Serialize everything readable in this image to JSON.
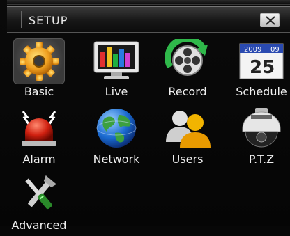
{
  "window": {
    "title": "SETUP",
    "close_label": "close"
  },
  "menu": {
    "items": [
      {
        "id": "basic",
        "label": "Basic",
        "icon": "gear-icon",
        "selected": true
      },
      {
        "id": "live",
        "label": "Live",
        "icon": "monitor-icon",
        "selected": false
      },
      {
        "id": "record",
        "label": "Record",
        "icon": "film-reel-icon",
        "selected": false
      },
      {
        "id": "schedule",
        "label": "Schedule",
        "icon": "calendar-icon",
        "selected": false
      },
      {
        "id": "alarm",
        "label": "Alarm",
        "icon": "siren-icon",
        "selected": false
      },
      {
        "id": "network",
        "label": "Network",
        "icon": "globe-icon",
        "selected": false
      },
      {
        "id": "users",
        "label": "Users",
        "icon": "users-icon",
        "selected": false
      },
      {
        "id": "ptz",
        "label": "P.T.Z",
        "icon": "dome-camera-icon",
        "selected": false
      },
      {
        "id": "advanced",
        "label": "Advanced",
        "icon": "tools-icon",
        "selected": false
      }
    ],
    "calendar": {
      "year": "2009",
      "month": "09",
      "day": "25"
    }
  },
  "colors": {
    "background": "#070707",
    "text": "#f0f0f0",
    "selected_tile": "#4a4a4a"
  }
}
